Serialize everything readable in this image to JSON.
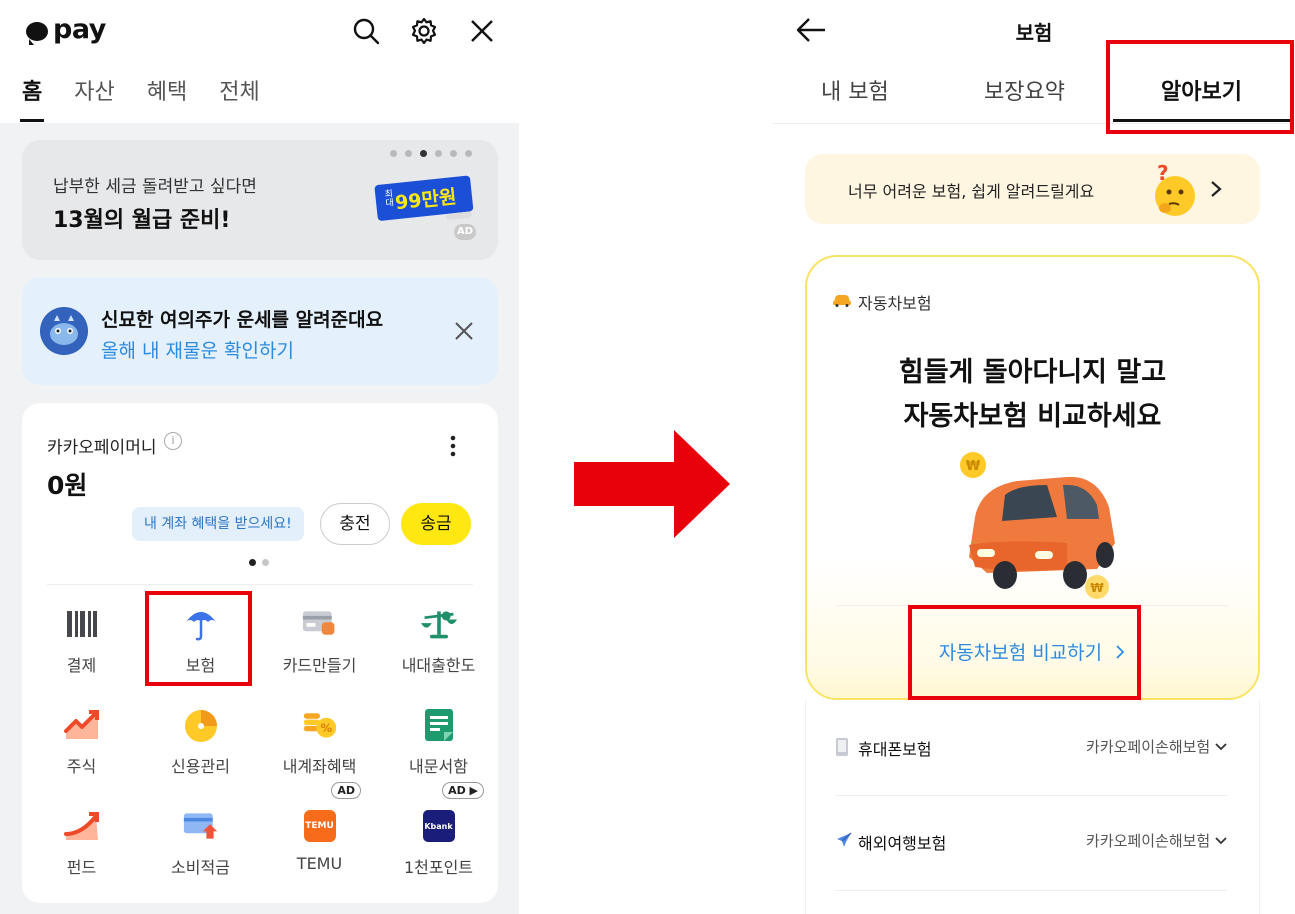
{
  "left": {
    "logo": "pay",
    "icons": {
      "search": "search-icon",
      "settings": "gear-icon",
      "close": "close-icon"
    },
    "tabs": [
      {
        "label": "홈",
        "active": true
      },
      {
        "label": "자산",
        "active": false
      },
      {
        "label": "혜택",
        "active": false
      },
      {
        "label": "전체",
        "active": false
      }
    ],
    "banner": {
      "line1": "납부한 세금 돌려받고 싶다면",
      "line2": "13월의 월급 준비!",
      "badge_small": "최대",
      "badge": "99만원",
      "ad": "AD",
      "page_count": 6,
      "page_active": 3
    },
    "fortune": {
      "title": "신묘한 여의주가 운세를 알려준대요",
      "link": "올해 내 재물운 확인하기"
    },
    "money": {
      "title": "카카오페이머니",
      "amount": "0원",
      "tooltip": "내 계좌 혜택을 받으세요!",
      "charge": "충전",
      "send": "송금"
    },
    "grid": [
      {
        "label": "결제",
        "icon": "barcode-icon"
      },
      {
        "label": "보험",
        "icon": "umbrella-icon",
        "highlight": true
      },
      {
        "label": "카드만들기",
        "icon": "card-icon"
      },
      {
        "label": "내대출한도",
        "icon": "scale-icon"
      },
      {
        "label": "주식",
        "icon": "stock-chart-icon"
      },
      {
        "label": "신용관리",
        "icon": "credit-gauge-icon"
      },
      {
        "label": "내계좌혜택",
        "icon": "coins-icon"
      },
      {
        "label": "내문서함",
        "icon": "document-icon"
      },
      {
        "label": "펀드",
        "icon": "fund-chart-icon"
      },
      {
        "label": "소비적금",
        "icon": "savings-card-icon"
      },
      {
        "label": "TEMU",
        "icon": "temu-icon",
        "ad": "AD"
      },
      {
        "label": "1천포인트",
        "icon": "kbank-icon",
        "ad": "AD ▶"
      }
    ],
    "temu_text": "TEMU",
    "kbank_text": "Kbank"
  },
  "right": {
    "title": "보험",
    "tabs": [
      {
        "label": "내 보험",
        "active": false
      },
      {
        "label": "보장요약",
        "active": false
      },
      {
        "label": "알아보기",
        "active": true
      }
    ],
    "hint": "너무 어려운 보험, 쉽게 알려드릴게요",
    "auto": {
      "tag": "자동차보험",
      "headline1": "힘들게 돌아다니지 말고",
      "headline2": "자동차보험 비교하세요",
      "cta": "자동차보험 비교하기"
    },
    "rows": [
      {
        "label": "휴대폰보험",
        "provider": "카카오페이손해보험",
        "icon": "phone-icon"
      },
      {
        "label": "해외여행보험",
        "provider": "카카오페이손해보험",
        "icon": "airplane-icon"
      }
    ]
  },
  "colors": {
    "highlight": "#e8000b",
    "kakao_yellow": "#ffe812",
    "link_blue": "#2c8be0"
  }
}
